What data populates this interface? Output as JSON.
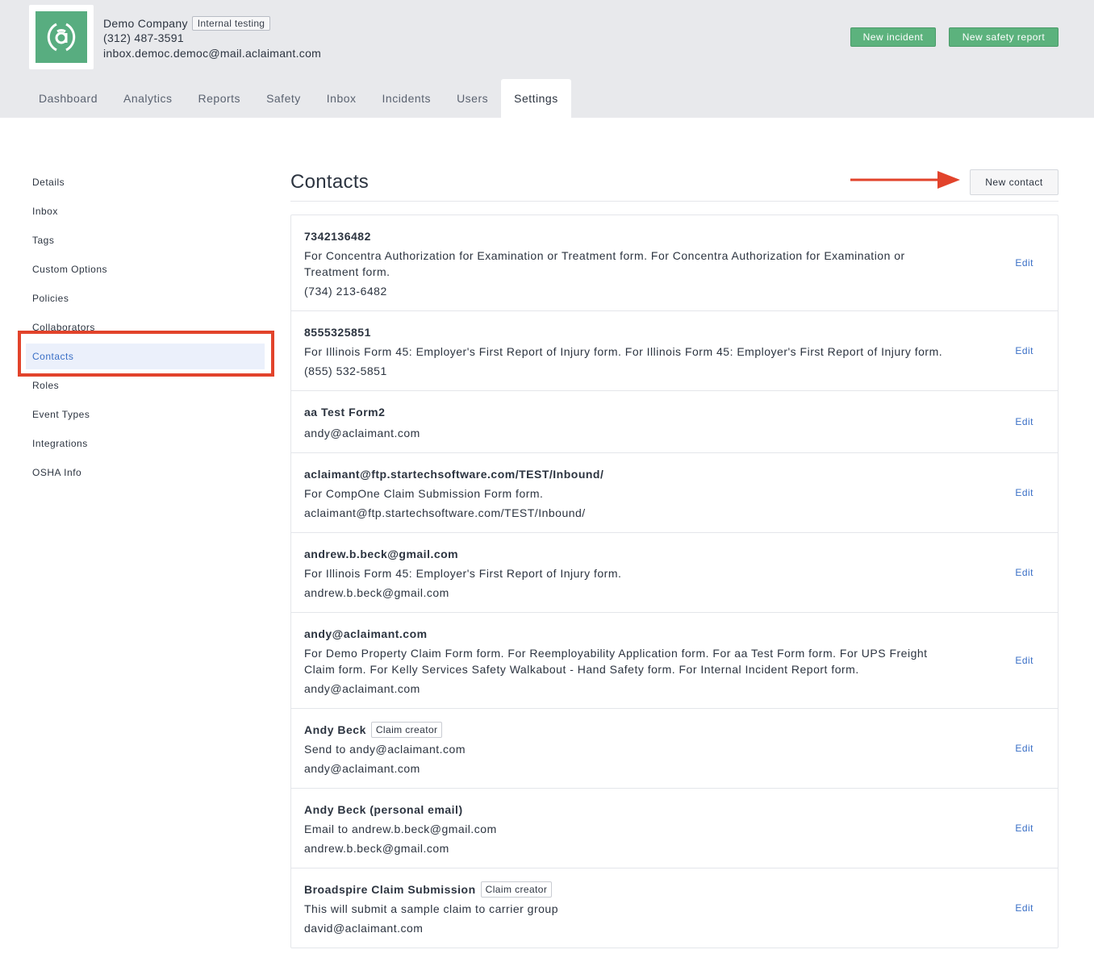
{
  "company": {
    "name": "Demo Company",
    "badge": "Internal testing",
    "phone": "(312) 487-3591",
    "email": "inbox.democ.democ@mail.aclaimant.com",
    "brand_color": "#58ad80"
  },
  "header_actions": {
    "new_incident": "New incident",
    "new_safety_report": "New safety report"
  },
  "tabs": [
    {
      "label": "Dashboard",
      "active": false
    },
    {
      "label": "Analytics",
      "active": false
    },
    {
      "label": "Reports",
      "active": false
    },
    {
      "label": "Safety",
      "active": false
    },
    {
      "label": "Inbox",
      "active": false
    },
    {
      "label": "Incidents",
      "active": false
    },
    {
      "label": "Users",
      "active": false
    },
    {
      "label": "Settings",
      "active": true
    }
  ],
  "sidebar": {
    "items": [
      {
        "label": "Details"
      },
      {
        "label": "Inbox"
      },
      {
        "label": "Tags"
      },
      {
        "label": "Custom Options"
      },
      {
        "label": "Policies"
      },
      {
        "label": "Collaborators"
      },
      {
        "label": "Contacts",
        "active": true
      },
      {
        "label": "Roles"
      },
      {
        "label": "Event Types"
      },
      {
        "label": "Integrations"
      },
      {
        "label": "OSHA Info"
      }
    ]
  },
  "contacts": {
    "title": "Contacts",
    "new_button": "New contact",
    "edit_label": "Edit",
    "items": [
      {
        "name": "7342136482",
        "desc": "For Concentra Authorization for Examination or Treatment form. For Concentra Authorization for Examination or Treatment form.",
        "address": "(734) 213-6482"
      },
      {
        "name": "8555325851",
        "desc": "For Illinois Form 45: Employer's First Report of Injury form. For Illinois Form 45: Employer's First Report of Injury form.",
        "address": "(855) 532-5851"
      },
      {
        "name": "aa Test Form2",
        "address": "andy@aclaimant.com"
      },
      {
        "name": "aclaimant@ftp.startechsoftware.com/TEST/Inbound/",
        "desc": "For CompOne Claim Submission Form form.",
        "address": "aclaimant@ftp.startechsoftware.com/TEST/Inbound/"
      },
      {
        "name": "andrew.b.beck@gmail.com",
        "desc": "For Illinois Form 45: Employer's First Report of Injury form.",
        "address": "andrew.b.beck@gmail.com"
      },
      {
        "name": "andy@aclaimant.com",
        "desc": "For Demo Property Claim Form form. For Reemployability Application form. For aa Test Form form. For UPS Freight Claim form. For Kelly Services Safety Walkabout - Hand Safety form. For Internal Incident Report form.",
        "address": "andy@aclaimant.com"
      },
      {
        "name": "Andy Beck",
        "badge": "Claim creator",
        "desc": "Send to andy@aclaimant.com",
        "address": "andy@aclaimant.com"
      },
      {
        "name": "Andy Beck (personal email)",
        "desc": "Email to andrew.b.beck@gmail.com",
        "address": "andrew.b.beck@gmail.com"
      },
      {
        "name": "Broadspire Claim Submission",
        "badge": "Claim creator",
        "desc": "This will submit a sample claim to carrier group",
        "address": "david@aclaimant.com"
      }
    ]
  }
}
